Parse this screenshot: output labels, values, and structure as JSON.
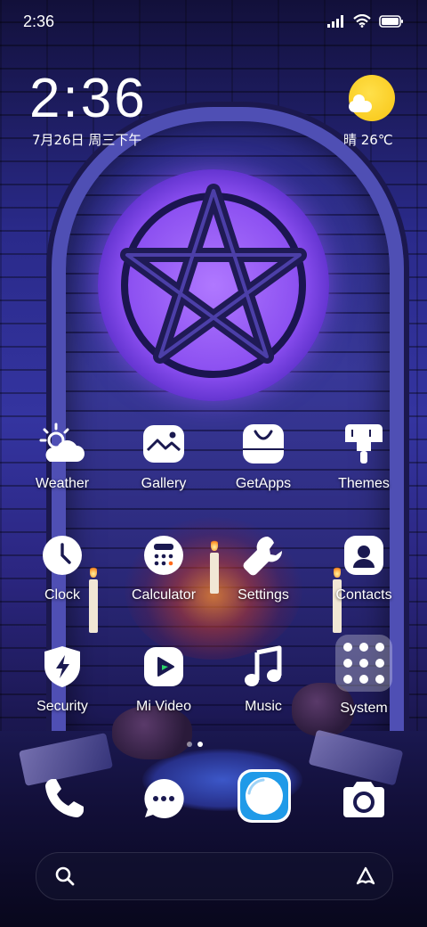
{
  "status_bar": {
    "time": "2:36",
    "icons": [
      "signal-icon",
      "wifi-icon",
      "battery-icon"
    ]
  },
  "clock_widget": {
    "time": "2:36",
    "date": "7月26日 周三下午"
  },
  "weather_widget": {
    "condition_icon": "sunny-cloud-icon",
    "text": "晴 26℃"
  },
  "apps": [
    {
      "label": "Weather",
      "icon": "weather-icon"
    },
    {
      "label": "Gallery",
      "icon": "gallery-icon"
    },
    {
      "label": "GetApps",
      "icon": "getapps-icon"
    },
    {
      "label": "Themes",
      "icon": "themes-icon"
    },
    {
      "label": "Clock",
      "icon": "clock-icon"
    },
    {
      "label": "Calculator",
      "icon": "calculator-icon"
    },
    {
      "label": "Settings",
      "icon": "settings-icon"
    },
    {
      "label": "Contacts",
      "icon": "contacts-icon"
    },
    {
      "label": "Security",
      "icon": "security-icon"
    },
    {
      "label": "Mi Video",
      "icon": "mi-video-icon"
    },
    {
      "label": "Music",
      "icon": "music-icon"
    },
    {
      "label": "System",
      "icon": "folder-icon"
    }
  ],
  "pages": {
    "count": 2,
    "active": 2
  },
  "dock": [
    {
      "icon": "phone-icon"
    },
    {
      "icon": "messages-icon"
    },
    {
      "icon": "browser-icon"
    },
    {
      "icon": "camera-icon"
    }
  ],
  "search_bar": {
    "left_icon": "search-icon",
    "right_icon": "assistant-icon"
  },
  "colors": {
    "accent": "#ffffff",
    "browser_blue": "#1f9ae8",
    "weather_sun": "#f8c514"
  }
}
